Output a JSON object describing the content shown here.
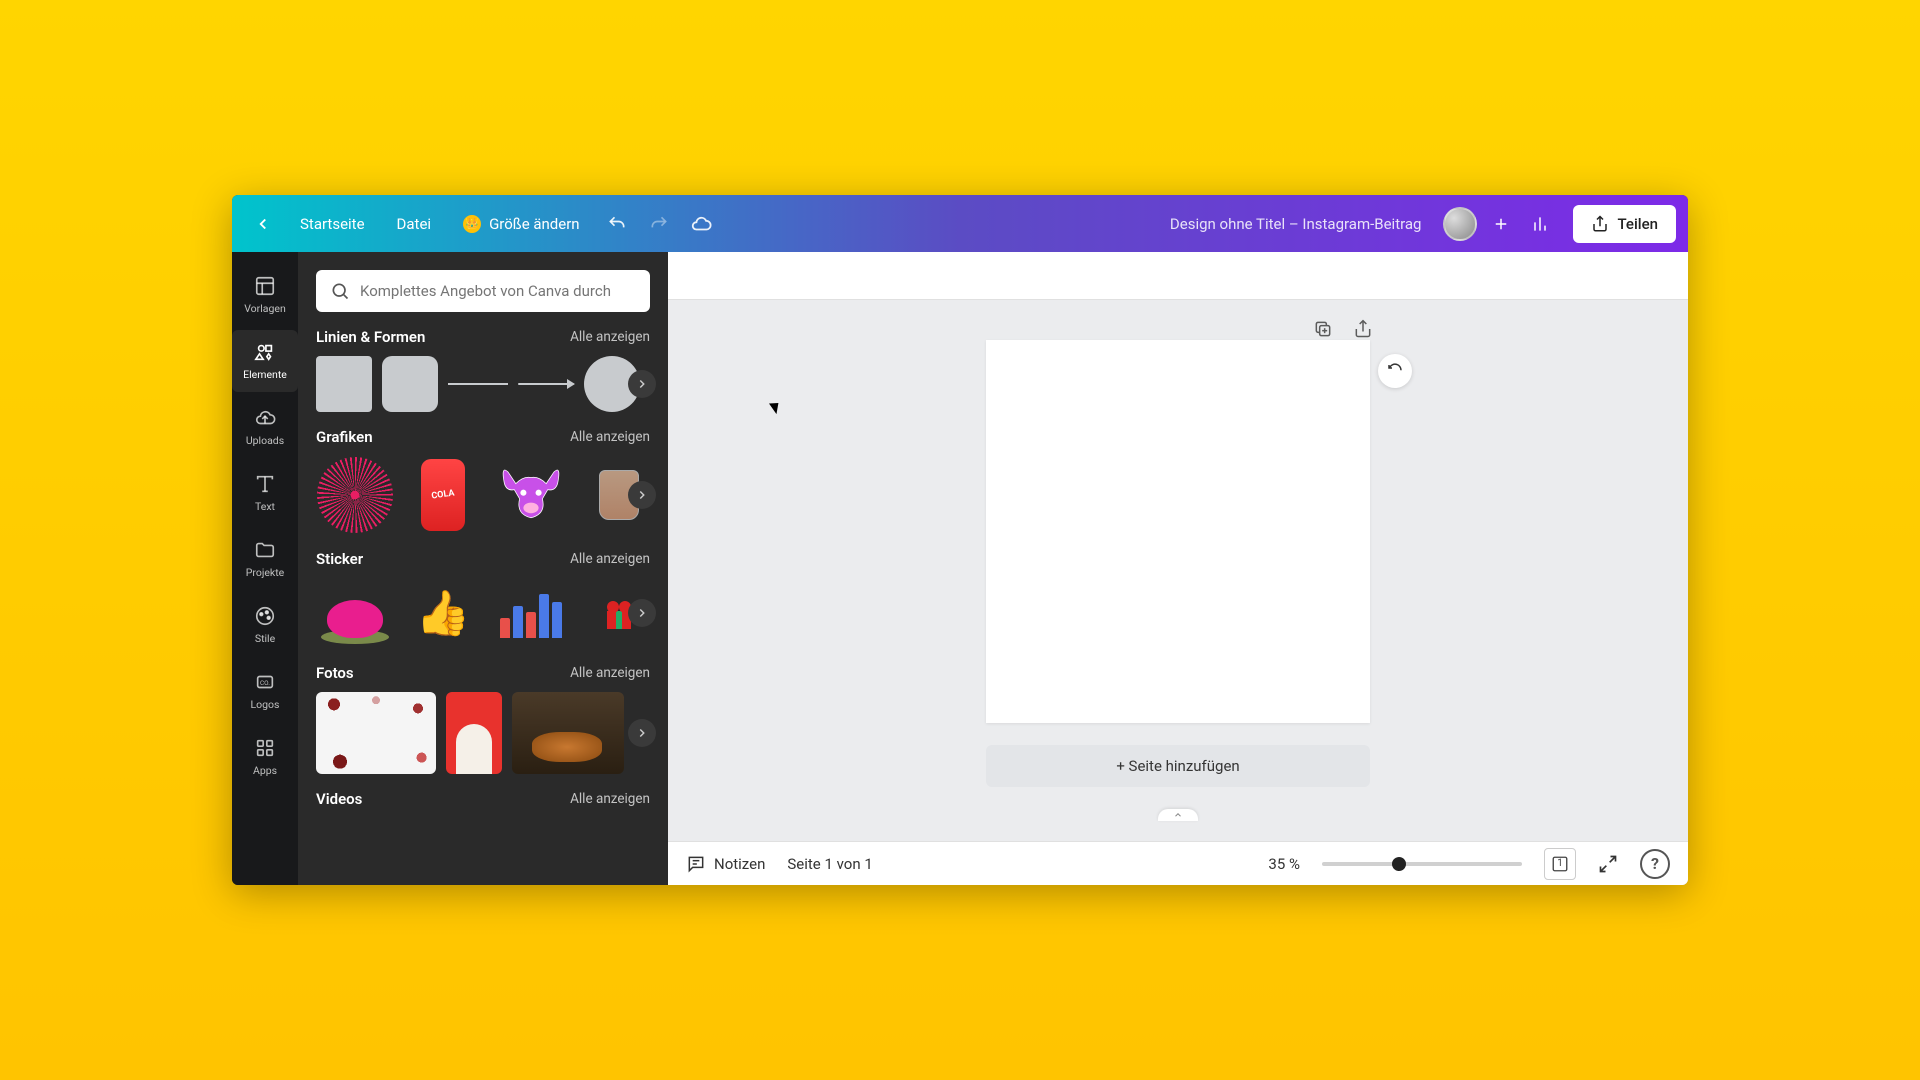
{
  "header": {
    "home": "Startseite",
    "file": "Datei",
    "resize": "Größe ändern",
    "title": "Design ohne Titel – Instagram-Beitrag",
    "share": "Teilen"
  },
  "rail": {
    "templates": "Vorlagen",
    "elements": "Elemente",
    "uploads": "Uploads",
    "text": "Text",
    "projects": "Projekte",
    "styles": "Stile",
    "logos": "Logos",
    "apps": "Apps"
  },
  "panel": {
    "search_placeholder": "Komplettes Angebot von Canva durch",
    "see_all": "Alle anzeigen",
    "sections": {
      "lines": "Linien & Formen",
      "graphics": "Grafiken",
      "stickers": "Sticker",
      "photos": "Fotos",
      "videos": "Videos"
    }
  },
  "canvas": {
    "add_page": "+ Seite hinzufügen"
  },
  "footer": {
    "notes": "Notizen",
    "page_indicator": "Seite 1 von 1",
    "zoom": "35 %",
    "zoom_value": 35,
    "page_badge": "1"
  }
}
